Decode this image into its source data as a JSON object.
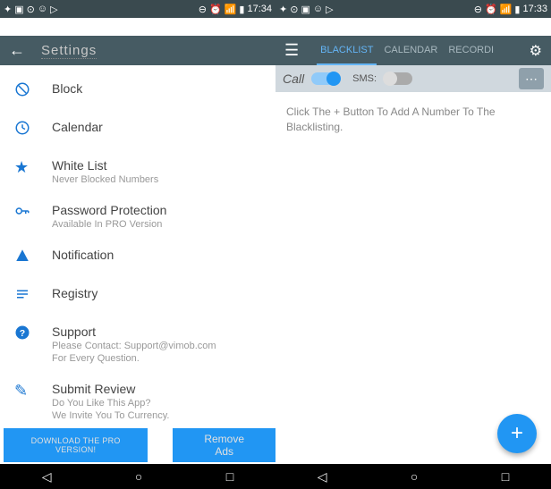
{
  "status": {
    "time_left": "17:34",
    "time_right": "17:33"
  },
  "left": {
    "title": "Settings",
    "items": {
      "block": {
        "label": "Block"
      },
      "calendar": {
        "label": "Calendar"
      },
      "whitelist": {
        "label": "White List",
        "sub": "Never Blocked Numbers"
      },
      "password": {
        "label": "Password Protection",
        "sub": "Available In PRO Version"
      },
      "notification": {
        "label": "Notification"
      },
      "registry": {
        "label": "Registry"
      },
      "support": {
        "label": "Support",
        "sub1": "Please Contact: Support@vimob.com",
        "sub2": "For Every Question."
      },
      "review": {
        "label": "Submit Review",
        "sub1": "Do You Like This App?",
        "sub2": "We Invite You To Currency."
      }
    },
    "btn_download": "DOWNLOAD THE PRO VERSION!",
    "btn_remove": "Remove Ads"
  },
  "right": {
    "tabs": {
      "blacklist": "BLACKLIST",
      "calendar": "CALENDAR",
      "recordi": "RECORDI"
    },
    "toggle": {
      "call": "Call",
      "sms": "SMS:"
    },
    "hint": "Click The + Button To Add A Number To The Blacklisting."
  }
}
